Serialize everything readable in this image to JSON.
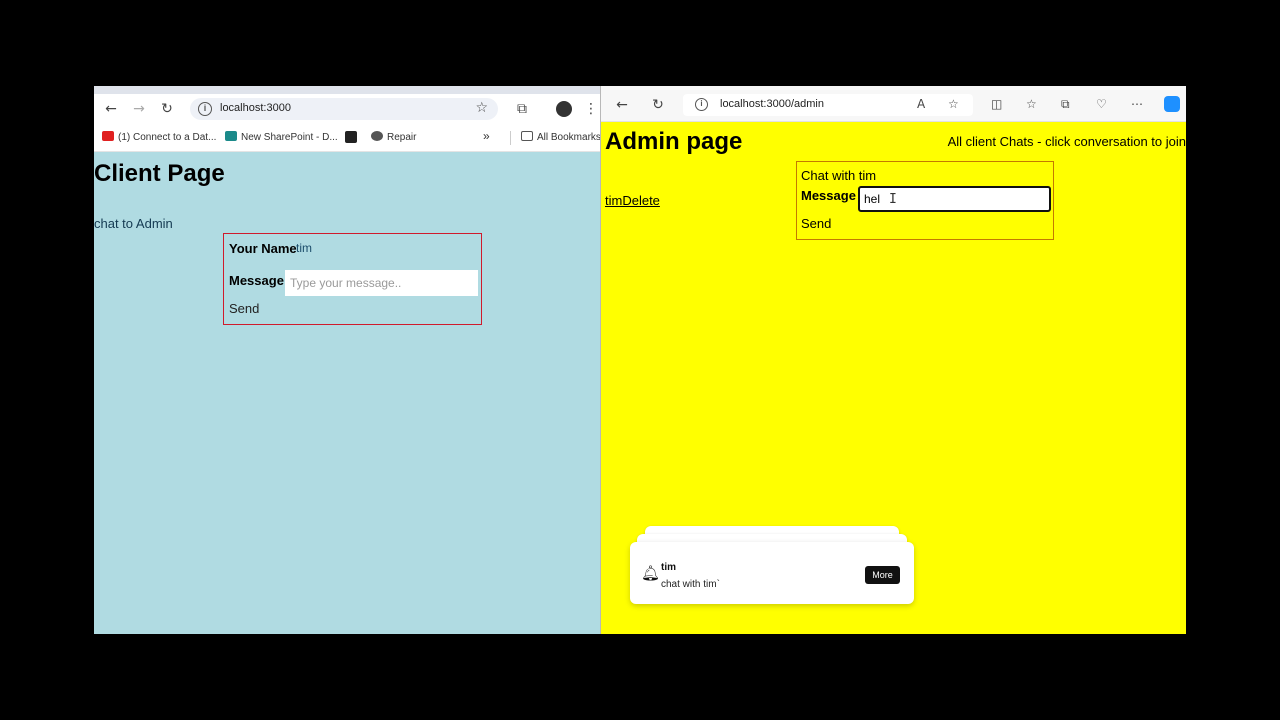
{
  "left_window": {
    "url": "localhost:3000",
    "bookmarks": [
      {
        "label": "(1) Connect to a Dat...",
        "color": "#e02020"
      },
      {
        "label": "New SharePoint - D...",
        "color": "#1b8a8a"
      },
      {
        "label": "",
        "color": "#222222"
      },
      {
        "label": "Repair",
        "color": "#555555"
      }
    ],
    "bookmarks_overflow": "»",
    "all_bookmarks": "All Bookmarks",
    "page_title": "Client Page",
    "chat_link": "chat to Admin",
    "form": {
      "name_label": "Your Name",
      "name_value": "tim",
      "message_label": "Message",
      "message_placeholder": "Type your message..",
      "send_label": "Send"
    },
    "background": "#b0dbe2",
    "form_border": "#d01a2c"
  },
  "right_window": {
    "url": "localhost:3000/admin",
    "page_title": "Admin page",
    "subtitle": "All client Chats - click conversation to join",
    "conversation_link": "timDelete",
    "chat_box": {
      "heading": "Chat with tim",
      "message_label": "Message",
      "message_value": "hel",
      "send_label": "Send"
    },
    "toast": {
      "title": "tim",
      "body": "chat with tim`",
      "button": "More"
    },
    "background": "#ffff00",
    "chat_border": "#c47a00"
  }
}
